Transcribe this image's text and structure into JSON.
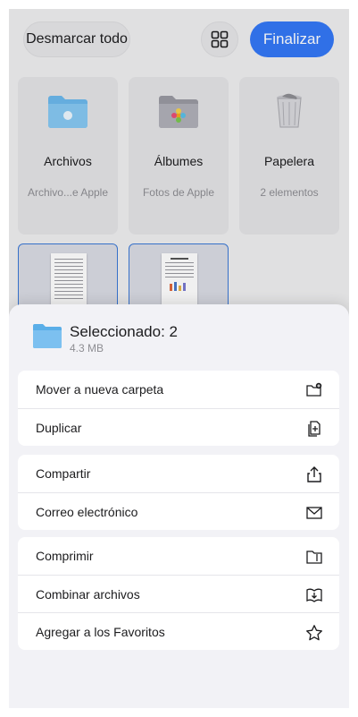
{
  "toolbar": {
    "deselect_label": "Desmarcar todo",
    "grid_icon": "grid-icon",
    "finish_label": "Finalizar"
  },
  "folders": [
    {
      "icon": "folder-icon",
      "title": "Archivos",
      "subtitle": "Archivo...e Apple"
    },
    {
      "icon": "photos-folder-icon",
      "title": "Álbumes",
      "subtitle": "Fotos de Apple"
    },
    {
      "icon": "trash-icon",
      "title": "Papelera",
      "subtitle": "2 elementos"
    }
  ],
  "selection": {
    "title": "Seleccionado: 2",
    "size": "4.3 MB"
  },
  "actions": [
    [
      {
        "label": "Mover a nueva carpeta",
        "icon": "new-folder-icon"
      },
      {
        "label": "Duplicar",
        "icon": "duplicate-icon"
      }
    ],
    [
      {
        "label": "Compartir",
        "icon": "share-icon"
      },
      {
        "label": "Correo electrónico",
        "icon": "mail-icon"
      }
    ],
    [
      {
        "label": "Comprimir",
        "icon": "compress-icon"
      },
      {
        "label": "Combinar archivos",
        "icon": "merge-icon"
      },
      {
        "label": "Agregar a los Favoritos",
        "icon": "star-icon"
      }
    ]
  ],
  "colors": {
    "accent": "#3478f6",
    "selection_border": "#3a78d6"
  }
}
